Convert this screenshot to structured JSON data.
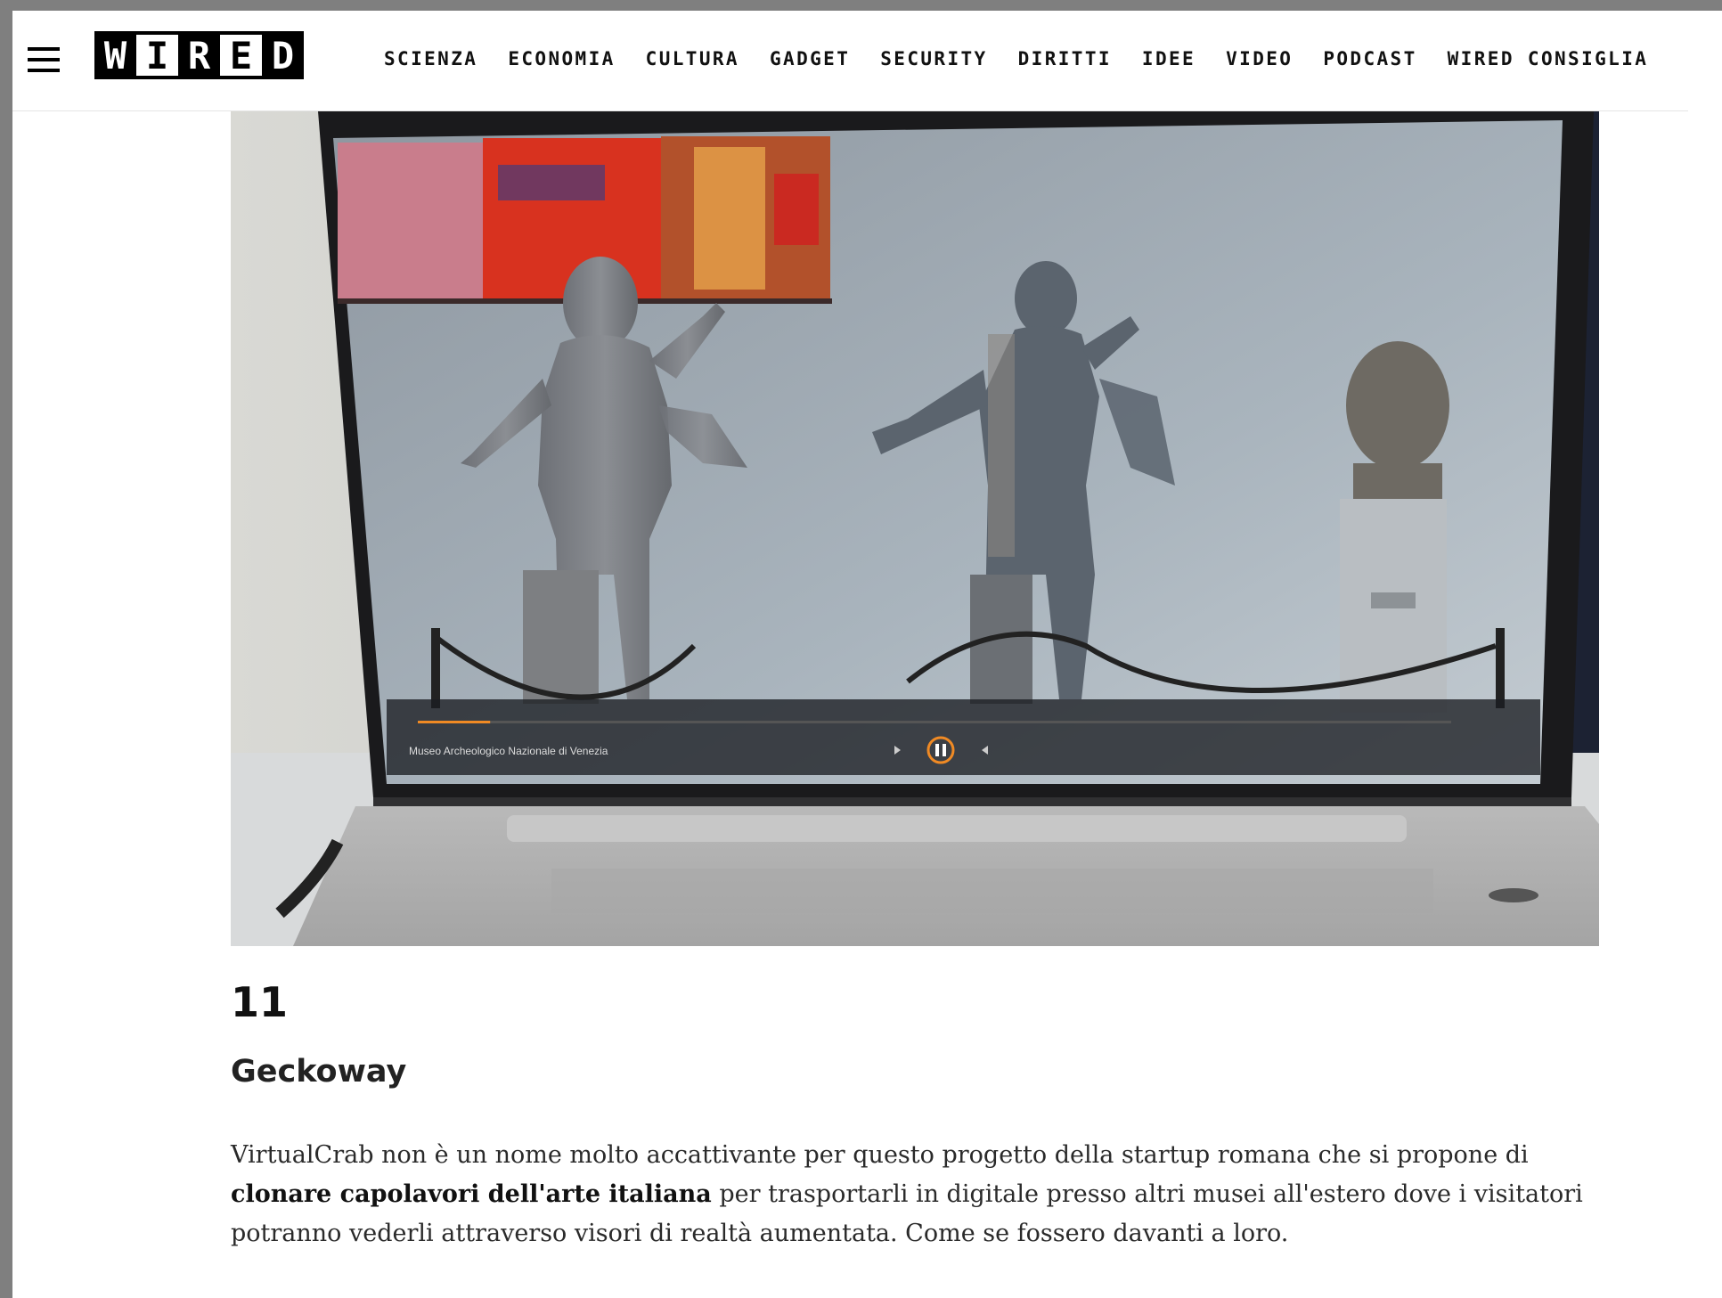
{
  "header": {
    "logo_letters": [
      "W",
      "I",
      "R",
      "E",
      "D"
    ],
    "nav": [
      "SCIENZA",
      "ECONOMIA",
      "CULTURA",
      "GADGET",
      "SECURITY",
      "DIRITTI",
      "IDEE",
      "VIDEO",
      "PODCAST",
      "WIRED CONSIGLIA"
    ]
  },
  "photo": {
    "video_caption": "Museo Archeologico Nazionale di Venezia",
    "progress": 0.07
  },
  "article": {
    "number": "11",
    "title": "Geckoway",
    "para_1": "VirtualCrab non è un nome molto accattivante per questo progetto della startup romana che si propone di ",
    "para_bold": "clonare capolavori dell'arte italiana",
    "para_2": " per trasportarli in digitale presso altri musei all'estero dove i visitatori potranno vederli attraverso visori di realtà aumentata. Come se fossero davanti a loro."
  }
}
